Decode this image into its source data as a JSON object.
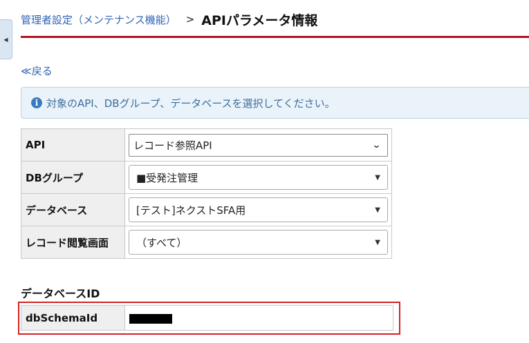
{
  "sidebar_toggle": {
    "icon": "caret-left-icon"
  },
  "header": {
    "breadcrumb_link": "管理者設定（メンテナンス機能）",
    "separator": ">",
    "title": "APIパラメータ情報",
    "rule_color": "#b0121f"
  },
  "back_link": "≪戻る",
  "info": {
    "icon": "info-circle-icon",
    "text": "対象のAPI、DBグループ、データベースを選択してください。"
  },
  "form": {
    "rows": [
      {
        "label": "API",
        "value": "レコード参照API"
      },
      {
        "label": "DBグループ",
        "value": "■受発注管理"
      },
      {
        "label": "データベース",
        "value": "[テスト]ネクストSFA用"
      },
      {
        "label": "レコード閲覧画面",
        "value": "（すべて）"
      }
    ]
  },
  "database_id": {
    "section_title": "データベースID",
    "label": "dbSchemaId",
    "highlight_color": "#d42020"
  }
}
